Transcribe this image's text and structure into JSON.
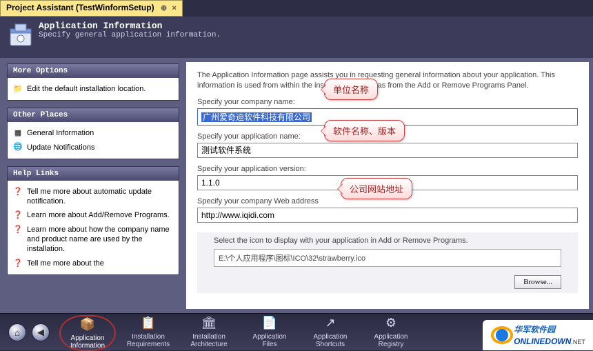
{
  "tab": {
    "title": "Project Assistant (TestWinformSetup)"
  },
  "header": {
    "title": "Application Information",
    "subtitle": "Specify general application information."
  },
  "sidebar": {
    "boxes": [
      {
        "title": "More Options",
        "items": [
          {
            "icon": "folder-icon",
            "label": "Edit the default installation location."
          }
        ]
      },
      {
        "title": "Other Places",
        "items": [
          {
            "icon": "grid-icon",
            "label": "General Information"
          },
          {
            "icon": "globe-refresh-icon",
            "label": "Update Notifications"
          }
        ]
      },
      {
        "title": "Help Links",
        "items": [
          {
            "icon": "help-icon",
            "label": "Tell me more about automatic update notification."
          },
          {
            "icon": "help-icon",
            "label": "Learn more about Add/Remove Programs."
          },
          {
            "icon": "help-icon",
            "label": "Learn more about how the company name and product name are used by the installation."
          },
          {
            "icon": "help-icon",
            "label": "Tell me more about the"
          }
        ]
      }
    ]
  },
  "main": {
    "help": "The Application Information page assists you in requesting general information about your application. This information is used from within the installation as well as from the Add or Remove Programs                                 Panel.",
    "company_label": "Specify your company name:",
    "company_value": "广州爱奇迪软件科技有限公司",
    "appname_label": "Specify your application name:",
    "appname_value": "测试软件系统",
    "version_label": "Specify your application version:",
    "version_value": "1.1.0",
    "website_label": "Specify your company Web address",
    "website_value": "http://www.iqidi.com",
    "icon_prompt": "Select the icon to display with your application in Add or Remove Programs.",
    "icon_path": "E:\\个人应用程序\\图标\\ICO\\32\\strawberry.ico",
    "browse_label": "Browse..."
  },
  "callouts": {
    "c1": "单位名称",
    "c2": "软件名称、版本",
    "c3": "公司网站地址"
  },
  "bottom": {
    "items": [
      {
        "label1": "Application",
        "label2": "Information",
        "selected": true
      },
      {
        "label1": "Installation",
        "label2": "Requirements"
      },
      {
        "label1": "Installation",
        "label2": "Architecture"
      },
      {
        "label1": "Application",
        "label2": "Files"
      },
      {
        "label1": "Application",
        "label2": "Shortcuts"
      },
      {
        "label1": "Application",
        "label2": "Registry"
      }
    ]
  },
  "watermark": {
    "cn": "华军软件园",
    "en": "ONLINEDOWN",
    "net": ".NET"
  }
}
